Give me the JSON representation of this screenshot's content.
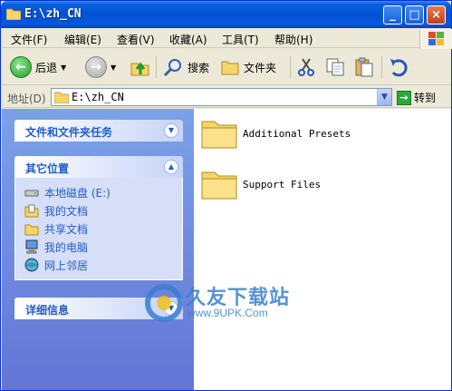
{
  "window": {
    "title": "E:\\zh_CN"
  },
  "menu": [
    "文件(F)",
    "编辑(E)",
    "查看(V)",
    "收藏(A)",
    "工具(T)",
    "帮助(H)"
  ],
  "toolbar": {
    "back_label": "后退",
    "search_label": "搜索",
    "folders_label": "文件夹"
  },
  "address": {
    "label": "地址(D)",
    "value": "E:\\zh_CN",
    "go_label": "转到"
  },
  "tasks": {
    "file_tasks_title": "文件和文件夹任务",
    "other_places_title": "其它位置",
    "other_places": [
      "本地磁盘 (E:)",
      "我的文档",
      "共享文档",
      "我的电脑",
      "网上邻居"
    ],
    "details_title": "详细信息"
  },
  "files": [
    "Additional Presets",
    "Support Files"
  ],
  "watermark": {
    "title": "久友下载站",
    "url": "www.9UPK.Com"
  },
  "colors": {
    "title_bar": "#0052d4",
    "task_link": "#215dc6",
    "task_pane": "#7ba2e7"
  }
}
